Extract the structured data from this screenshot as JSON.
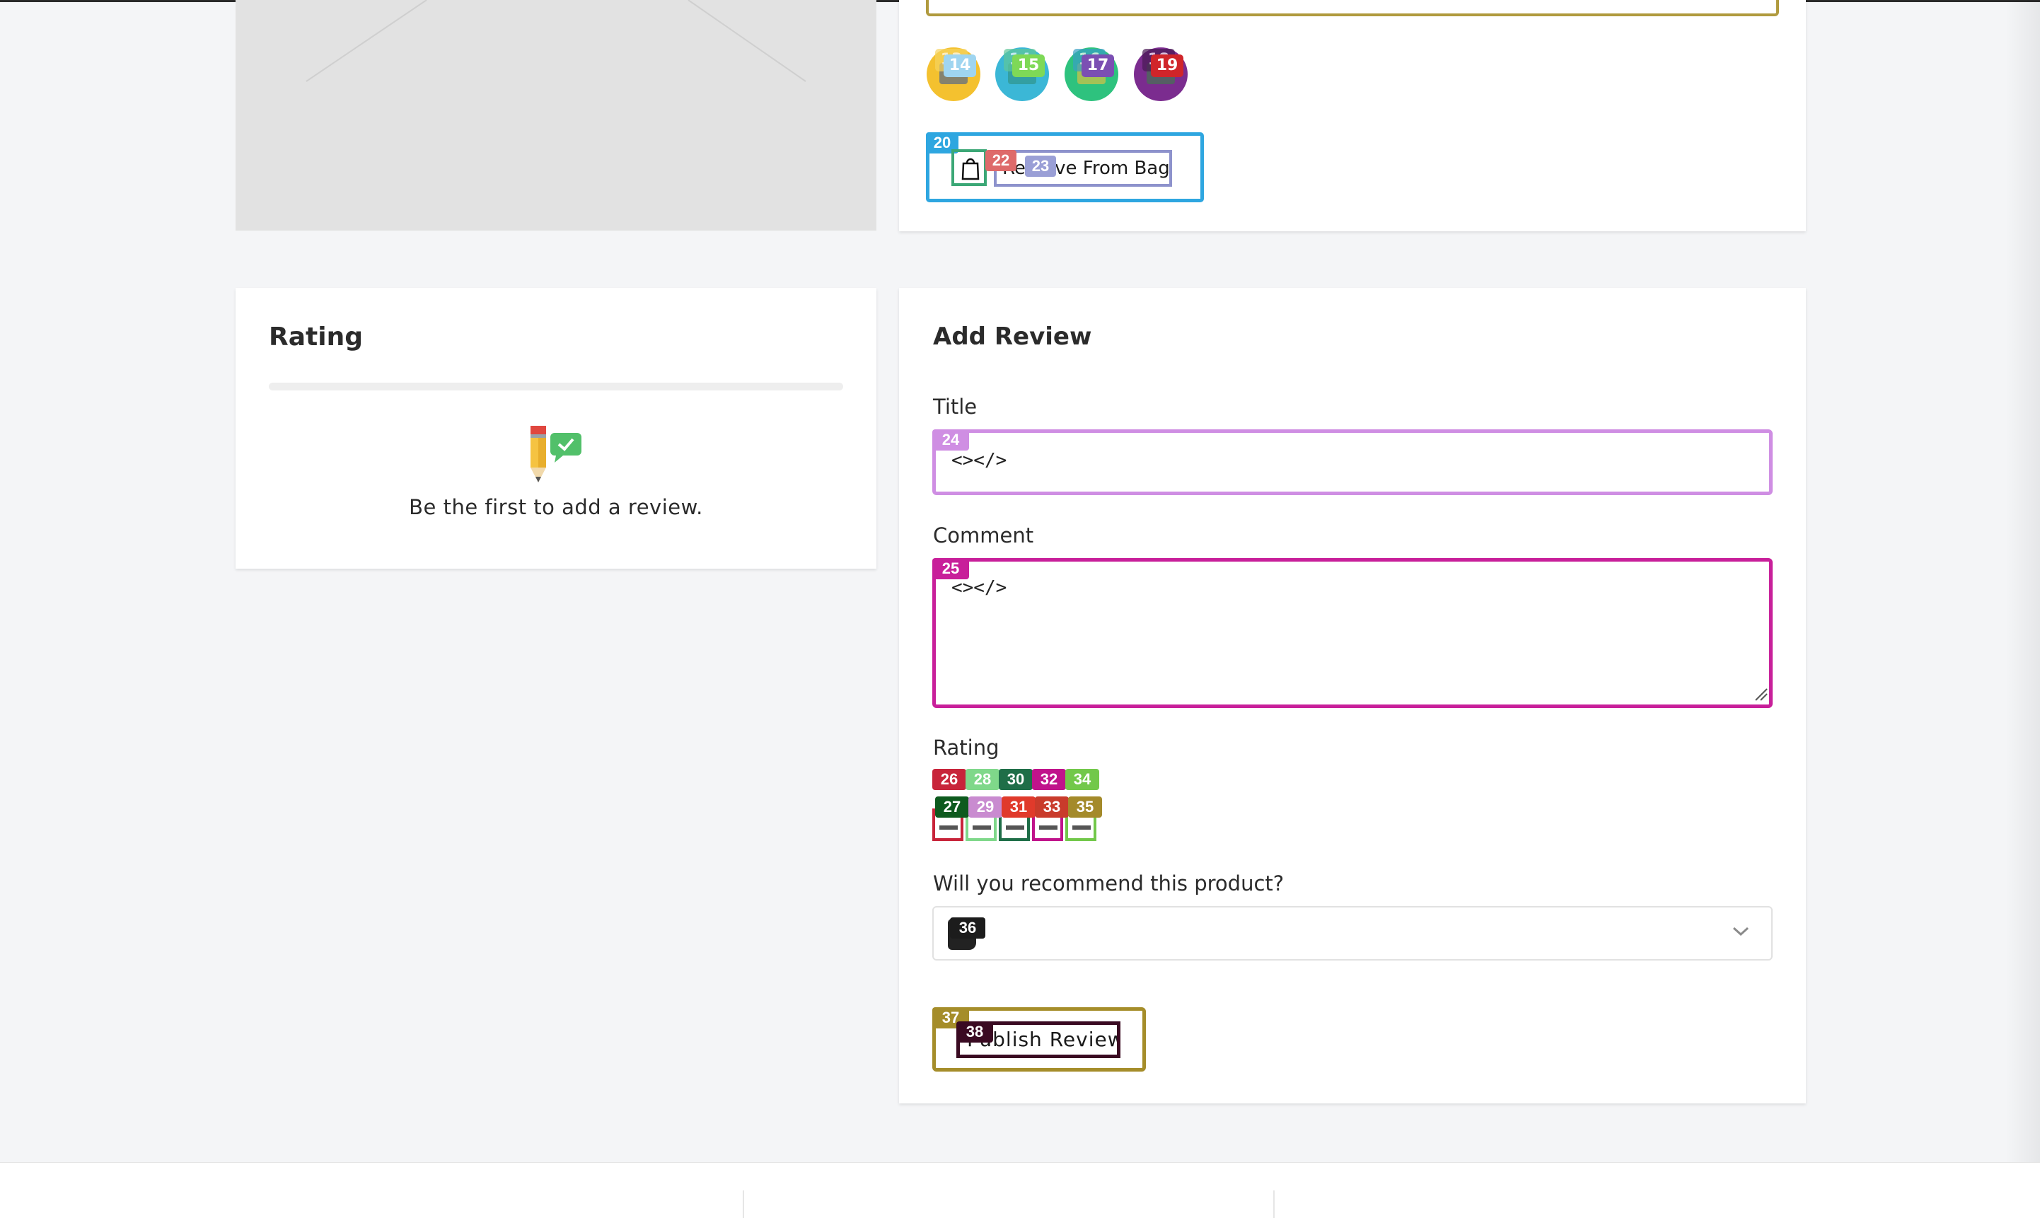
{
  "share_icons": [
    {
      "name": "facebook-share",
      "label_back": "13",
      "label_front": "14",
      "color": "#f4c12f",
      "tag_color": "#9fd5f0"
    },
    {
      "name": "twitter-share",
      "label_back": "14",
      "label_front": "15",
      "color": "#3bb7d6",
      "tag_color": "#7ed957"
    },
    {
      "name": "email-share",
      "label_back": "16",
      "label_front": "17",
      "color": "#2ec27e",
      "tag_color": "#7b4fb3"
    },
    {
      "name": "pinterest-share",
      "label_back": "18",
      "label_front": "19",
      "color": "#7b2c8f",
      "tag_color": "#d0252a"
    }
  ],
  "bag_button": {
    "label": "Remove From Bag",
    "badge_outer": "20",
    "badge_icon": "22",
    "badge_label": "23"
  },
  "rating_panel": {
    "title": "Rating",
    "empty_text": "Be the first to add a review."
  },
  "add_review": {
    "title": "Add Review",
    "title_label": "Title",
    "title_value": "<></>",
    "title_badge": "24",
    "comment_label": "Comment",
    "comment_value": "<></>",
    "comment_badge": "25",
    "rating_label": "Rating",
    "stars": [
      {
        "top": "26",
        "bottom": "27",
        "top_color": "#c8243a",
        "bottom_color": "#0d5a1e",
        "border": "#c8243a"
      },
      {
        "top": "28",
        "bottom": "29",
        "top_color": "#7fd88a",
        "bottom_color": "#c98bd0",
        "border": "#7fd88a"
      },
      {
        "top": "30",
        "bottom": "31",
        "top_color": "#1f6e48",
        "bottom_color": "#e03a2b",
        "border": "#1f6e48"
      },
      {
        "top": "32",
        "bottom": "33",
        "top_color": "#c0138b",
        "bottom_color": "#c93b2b",
        "border": "#c0138b"
      },
      {
        "top": "34",
        "bottom": "35",
        "top_color": "#72c84a",
        "bottom_color": "#a48a2a",
        "border": "#72c84a"
      }
    ],
    "recommend_label": "Will you recommend this product?",
    "recommend_badge": "36",
    "publish_label": "Publish Review",
    "publish_badge_outer": "37",
    "publish_badge_inner": "38"
  },
  "colors": {
    "accent_title": "#cf8ee3",
    "accent_comment": "#c81f9a",
    "accent_bag": "#2ea6e0",
    "accent_publish": "#a58d2a"
  }
}
